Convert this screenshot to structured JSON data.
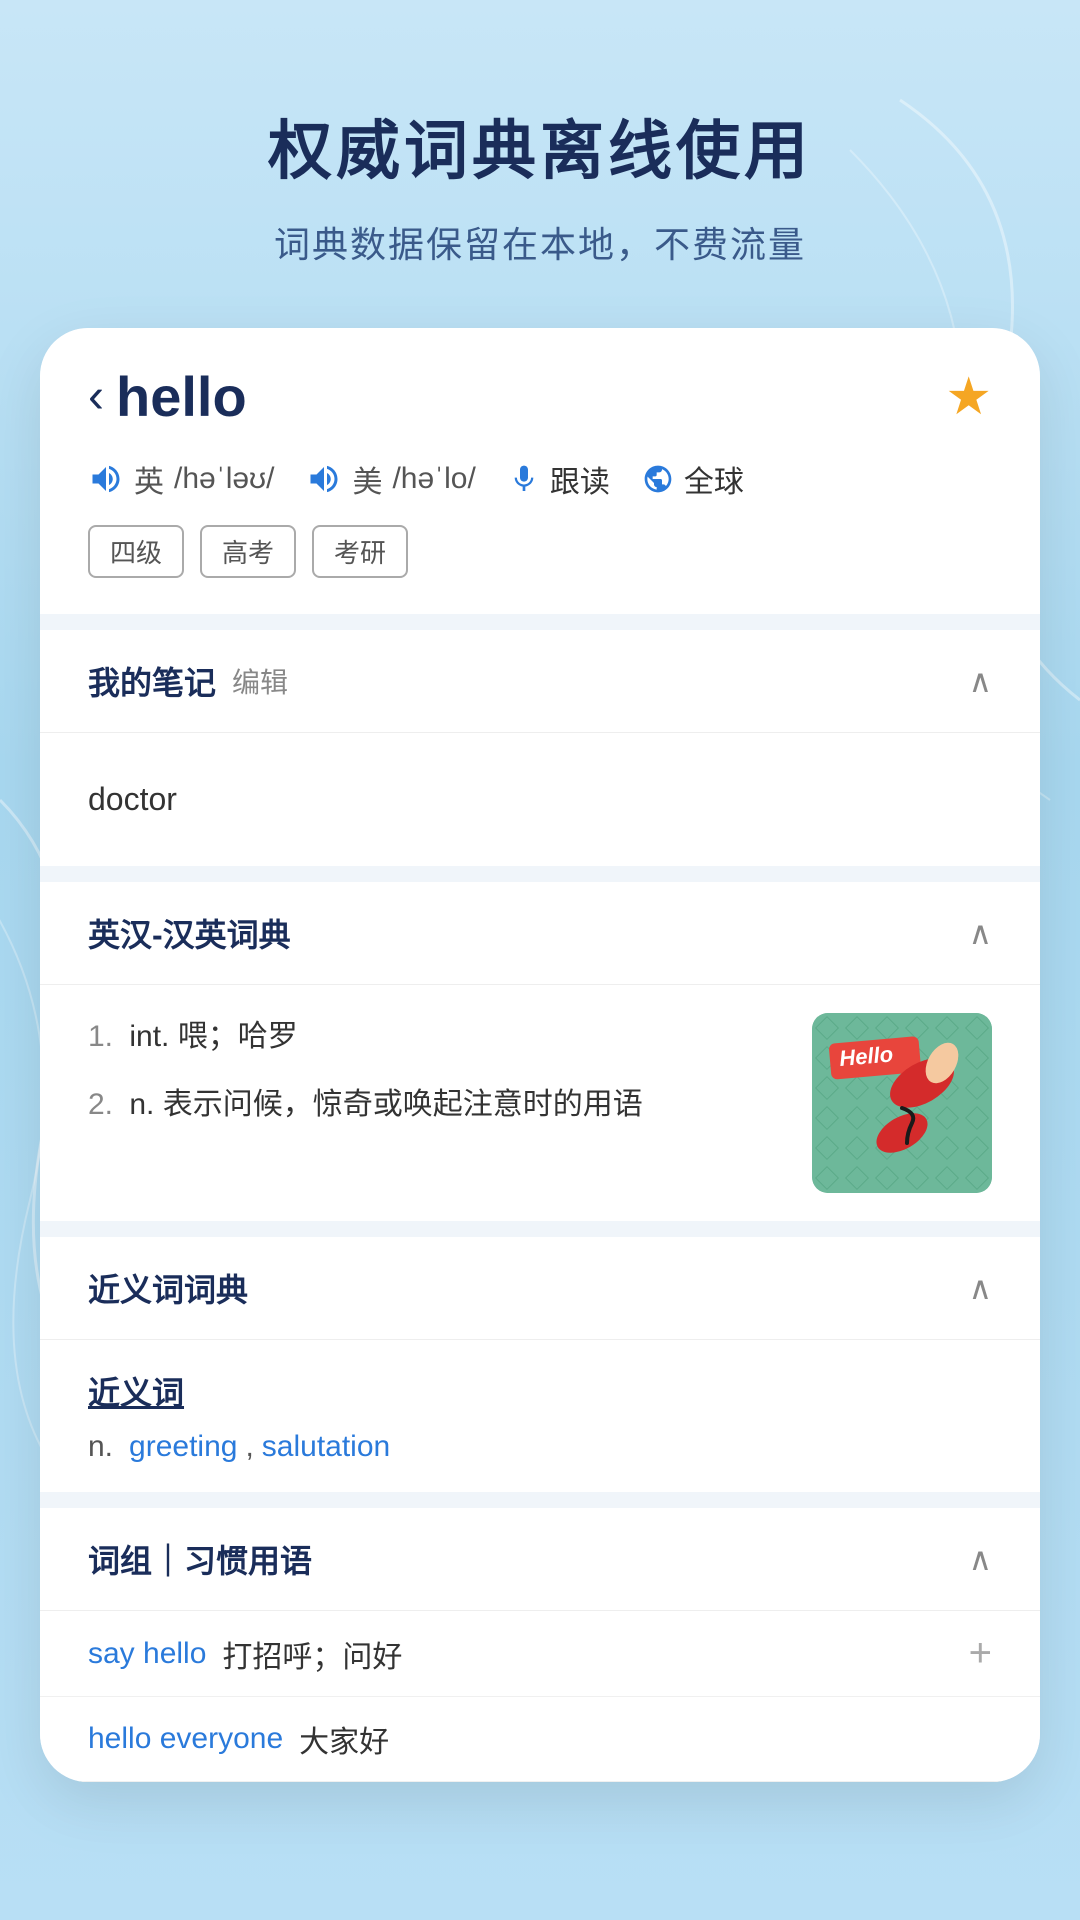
{
  "app": {
    "main_title": "权威词典离线使用",
    "sub_title": "词典数据保留在本地，不费流量"
  },
  "word_card": {
    "back_label": "‹",
    "word": "hello",
    "star_icon": "★",
    "pronunciations": [
      {
        "flag": "英",
        "phonetic": "/həˈləʊ/"
      },
      {
        "flag": "美",
        "phonetic": "/həˈlo/"
      }
    ],
    "actions": [
      {
        "label": "跟读"
      },
      {
        "label": "全球"
      }
    ],
    "tags": [
      "四级",
      "高考",
      "考研"
    ]
  },
  "notes_section": {
    "title": "我的笔记",
    "edit_label": "编辑",
    "content": "doctor",
    "collapse_icon": "∧"
  },
  "dictionary_section": {
    "title": "英汉-汉英词典",
    "collapse_icon": "∧",
    "definitions": [
      {
        "num": "1.",
        "pos": "int.",
        "meaning": "喂；哈罗"
      },
      {
        "num": "2.",
        "pos": "n.",
        "meaning": "表示问候，惊奇或唤起注意时的用语"
      }
    ],
    "image_alt": "Hello telephone illustration"
  },
  "synonym_section": {
    "title": "近义词词典",
    "collapse_icon": "∧",
    "synonym_heading": "近义词",
    "pos": "n.",
    "synonyms": [
      {
        "word": "greeting",
        "comma": ","
      },
      {
        "word": "salutation"
      }
    ]
  },
  "phrases_section": {
    "title": "词组｜习惯用语",
    "collapse_icon": "∧",
    "phrases": [
      {
        "english": "say hello",
        "chinese": "打招呼；问好",
        "has_add": true
      },
      {
        "english": "hello everyone",
        "chinese": "大家好",
        "has_add": false
      }
    ]
  }
}
